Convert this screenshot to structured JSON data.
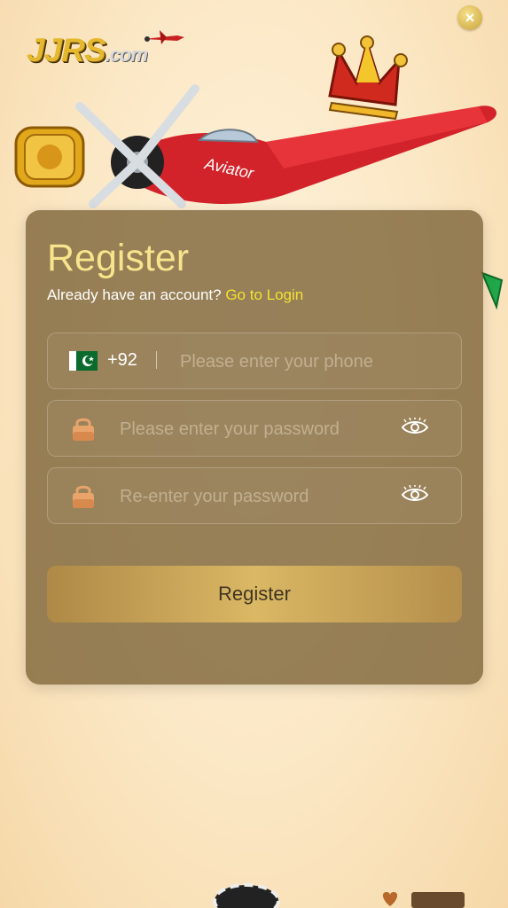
{
  "brand": {
    "logo_main": "JJRS",
    "logo_suffix": ".com",
    "plane_text": "Aviator"
  },
  "close": {
    "label": "×"
  },
  "form": {
    "title": "Register",
    "account_prompt": "Already have an account?",
    "login_link": "Go to Login",
    "phone": {
      "country_code": "+92",
      "placeholder": "Please enter your phone"
    },
    "password": {
      "placeholder": "Please enter your password"
    },
    "confirm_password": {
      "placeholder": "Re-enter your password"
    },
    "submit_label": "Register"
  },
  "colors": {
    "title": "#f7e48c",
    "link": "#f3e12f",
    "card": "#7a6034",
    "button": "#e0bd66"
  },
  "icons": {
    "flag": "pakistan-flag-icon",
    "lock": "lock-icon",
    "eye": "eye-icon",
    "close": "close-icon"
  }
}
